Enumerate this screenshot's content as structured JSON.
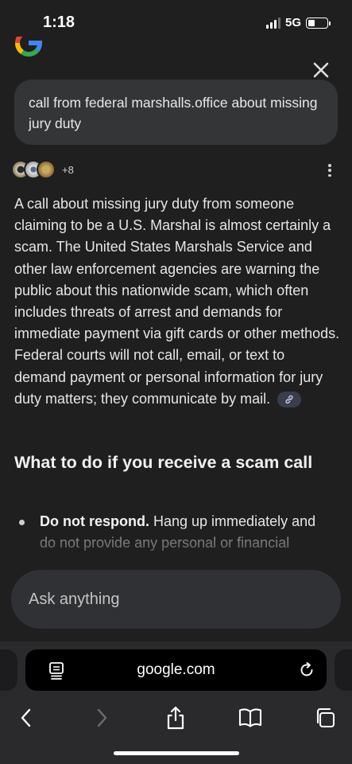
{
  "status_bar": {
    "time": "1:18",
    "network": "5G"
  },
  "query": {
    "text": "call from federal marshalls.office about missing jury duty"
  },
  "sources": {
    "more_count": "+8"
  },
  "answer": {
    "paragraph": "A call about missing jury duty from someone claiming to be a U.S. Marshal is almost certainly a scam. The United States Marshals Service and other law enforcement agencies are warning the public about this nationwide scam, which often includes threats of arrest and demands for immediate payment via gift cards or other methods. Federal courts will not call, email, or text to demand payment or personal information for jury duty matters; they communicate by mail."
  },
  "section": {
    "heading": "What to do if you receive a scam call",
    "bullets": [
      {
        "bold": "Do not respond.",
        "text": " Hang up immediately and do not provide any personal or financial"
      }
    ]
  },
  "ask_box": {
    "placeholder": "Ask anything"
  },
  "browser": {
    "url": "google.com"
  },
  "colors": {
    "background": "#1f1f1f",
    "query_bubble": "#333537",
    "ask_box": "#303134",
    "toolbar": "#2a2a2c",
    "disabled_icon": "#6d6d6d"
  },
  "icons": {
    "logo": "google-g-logo",
    "close": "close-icon",
    "menu": "more-vert-icon",
    "link": "link-icon",
    "reader": "reader-mode-icon",
    "reload": "reload-icon",
    "back": "back-chevron-icon",
    "forward": "forward-chevron-icon",
    "share": "share-icon",
    "bookmarks": "bookmarks-icon",
    "tabs": "tabs-icon"
  }
}
